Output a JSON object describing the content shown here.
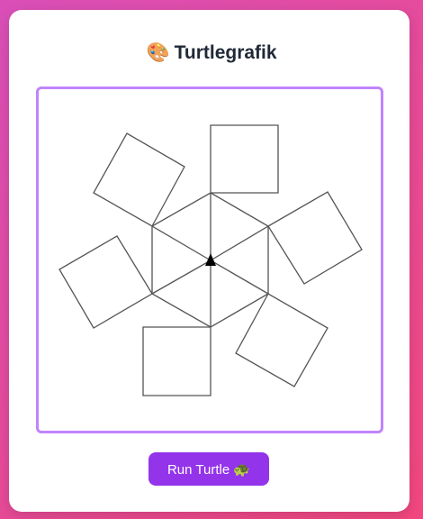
{
  "header": {
    "icon": "palette-icon",
    "icon_glyph": "🎨",
    "title": "Turtlegrafik"
  },
  "canvas": {
    "description": "turtle-drawing"
  },
  "controls": {
    "run_label": "Run Turtle 🐢"
  },
  "colors": {
    "accent": "#9333ea",
    "canvas_border": "#c084fc",
    "stroke": "#555555"
  }
}
